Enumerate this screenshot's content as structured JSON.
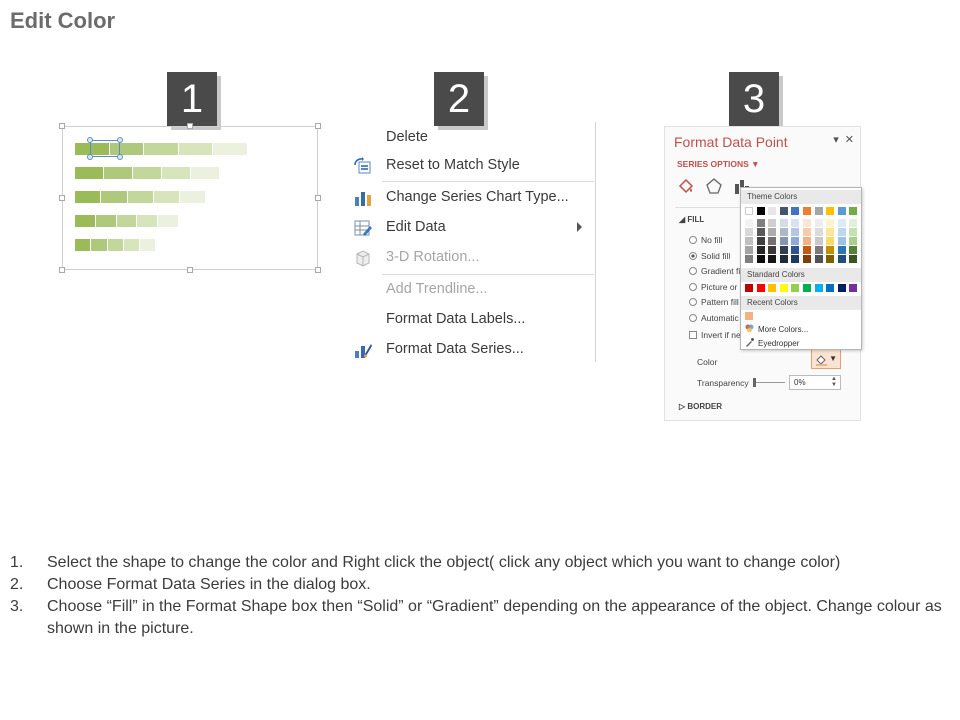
{
  "title": "Edit Color",
  "badges": [
    "1",
    "2",
    "3"
  ],
  "colors": {
    "badge_bg": "#4a4a4a",
    "accent": "#c0504d",
    "bar_shades": [
      "#9bbb59",
      "#afc97c",
      "#c4d79b",
      "#d8e4bc",
      "#ebf1de"
    ]
  },
  "chart": {
    "bar_fractions": [
      1.0,
      0.84,
      0.76,
      0.6,
      0.47
    ],
    "selected_segment": "first"
  },
  "context_menu": {
    "items": [
      {
        "label": "Delete",
        "icon": "none",
        "disabled": false
      },
      {
        "label": "Reset to Match Style",
        "icon": "reset-style-icon",
        "disabled": false
      },
      {
        "label": "Change Series Chart Type...",
        "icon": "chart-type-icon",
        "disabled": false
      },
      {
        "label": "Edit Data",
        "icon": "edit-data-icon",
        "disabled": false,
        "submenu": true
      },
      {
        "label": "3-D Rotation...",
        "icon": "rotation-3d-icon",
        "disabled": true
      },
      {
        "label": "Add Trendline...",
        "icon": "none",
        "disabled": true
      },
      {
        "label": "Format Data Labels...",
        "icon": "none",
        "disabled": false
      },
      {
        "label": "Format Data Series...",
        "icon": "format-series-icon",
        "disabled": false
      }
    ]
  },
  "format_pane": {
    "title": "Format Data Point",
    "series_options": "SERIES OPTIONS ▼",
    "fill_header": "◢ FILL",
    "options": [
      {
        "label": "No fill",
        "type": "radio",
        "selected": false
      },
      {
        "label": "Solid fill",
        "type": "radio",
        "selected": true
      },
      {
        "label": "Gradient fi",
        "type": "radio",
        "selected": false
      },
      {
        "label": "Picture or",
        "type": "radio",
        "selected": false
      },
      {
        "label": "Pattern fill",
        "type": "radio",
        "selected": false
      },
      {
        "label": "Automatic",
        "type": "radio",
        "selected": false
      },
      {
        "label": "Invert if ne",
        "type": "checkbox",
        "selected": false
      }
    ],
    "color_label": "Color",
    "transparency_label": "Transparency",
    "transparency_value": "0%",
    "border_header": "▷ BORDER"
  },
  "color_popup": {
    "theme_header": "Theme Colors",
    "theme_top": [
      "#ffffff",
      "#000000",
      "#e7e6e6",
      "#44546a",
      "#4472c4",
      "#ed7d31",
      "#a5a5a5",
      "#ffc000",
      "#5b9bd5",
      "#70ad47"
    ],
    "theme_shades": [
      [
        "#f2f2f2",
        "#7f7f7f",
        "#d0cece",
        "#d6dce4",
        "#d9e2f3",
        "#fbe5d5",
        "#ededed",
        "#fff2cc",
        "#deebf6",
        "#e2efd9"
      ],
      [
        "#d8d8d8",
        "#595959",
        "#aeabab",
        "#adb9ca",
        "#b4c6e7",
        "#f7cbac",
        "#dbdbdb",
        "#fee599",
        "#bdd7ee",
        "#c5e0b3"
      ],
      [
        "#bfbfbf",
        "#3f3f3f",
        "#757070",
        "#8496b0",
        "#8eaadb",
        "#f4b183",
        "#c9c9c9",
        "#ffd965",
        "#9cc3e5",
        "#a8d08d"
      ],
      [
        "#a5a5a5",
        "#262626",
        "#3a3838",
        "#323f4f",
        "#2f5496",
        "#c55a11",
        "#7b7b7b",
        "#bf9000",
        "#2e75b5",
        "#538135"
      ],
      [
        "#7f7f7f",
        "#0c0c0c",
        "#171616",
        "#222a35",
        "#1f3864",
        "#833c0b",
        "#525252",
        "#7f6000",
        "#1e4e79",
        "#375623"
      ]
    ],
    "standard_header": "Standard Colors",
    "standard": [
      "#c00000",
      "#ff0000",
      "#ffc000",
      "#ffff00",
      "#92d050",
      "#00b050",
      "#00b0f0",
      "#0070c0",
      "#002060",
      "#7030a0"
    ],
    "recent_header": "Recent Colors",
    "recent": [
      "#f4b183"
    ],
    "more_colors": "More Colors...",
    "eyedropper": "Eyedropper"
  },
  "steps": [
    {
      "num": "1.",
      "text": "Select the shape to change the color and Right click the object( click any object which you want to change color)"
    },
    {
      "num": "2.",
      "text": "Choose Format Data Series in the dialog box."
    },
    {
      "num": "3.",
      "text": "Choose “Fill” in the Format Shape box then “Solid” or “Gradient” depending on the appearance of the object. Change colour as shown in the picture."
    }
  ]
}
